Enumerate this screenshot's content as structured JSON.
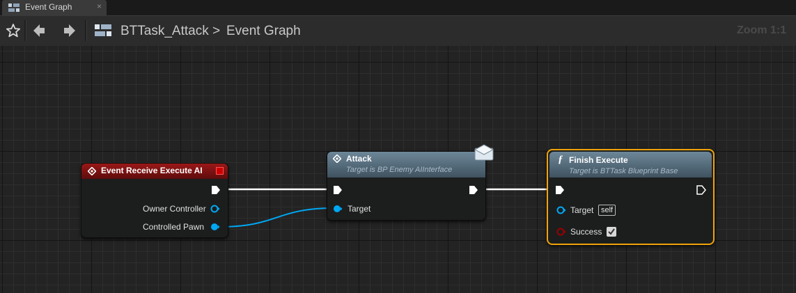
{
  "tab": {
    "label": "Event Graph",
    "close": "×"
  },
  "toolbar": {
    "breadcrumb_asset": "BTTask_Attack",
    "breadcrumb_separator": ">",
    "breadcrumb_graph": "Event Graph",
    "zoom": "Zoom 1:1"
  },
  "nodes": {
    "event_receive": {
      "title": "Event Receive Execute AI",
      "pins": {
        "owner": "Owner Controller",
        "pawn": "Controlled Pawn"
      },
      "color": "#8a1414"
    },
    "attack": {
      "title": "Attack",
      "subtitle": "Target is BP Enemy AIInterface",
      "pins": {
        "target": "Target"
      },
      "color": "#5b7384"
    },
    "finish_execute": {
      "title": "Finish Execute",
      "subtitle": "Target is BTTask Blueprint Base",
      "pins": {
        "target": "Target",
        "target_default": "self",
        "success": "Success"
      },
      "success_checked": true,
      "color": "#5b7384",
      "selection_color": "#f0a30a"
    }
  },
  "colors": {
    "exec_wire": "#ffffff",
    "object_pin": "#00a8f3",
    "bool_pin": "#9a0000",
    "grid_major": "#141414"
  },
  "icons": {
    "tab": "blueprint-graph-icon",
    "favorite": "star-icon",
    "back": "arrow-left-icon",
    "forward": "arrow-right-icon",
    "asset": "blueprint-graph-icon",
    "message": "envelope-icon",
    "function": "function-icon",
    "event": "event-diamond-icon"
  }
}
